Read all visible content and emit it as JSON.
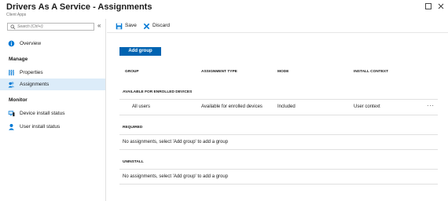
{
  "header": {
    "title": "Drivers As A Service - Assignments",
    "subtitle": "Client Apps"
  },
  "sidebar": {
    "search_placeholder": "Search (Ctrl+/)",
    "collapse_glyph": "«",
    "overview": "Overview",
    "manage_label": "Manage",
    "properties": "Properties",
    "assignments": "Assignments",
    "monitor_label": "Monitor",
    "device_install_status": "Device install status",
    "user_install_status": "User install status"
  },
  "toolbar": {
    "save_label": "Save",
    "discard_label": "Discard"
  },
  "main": {
    "add_group_label": "Add group",
    "columns": [
      "GROUP",
      "ASSIGNMENT TYPE",
      "MODE",
      "INSTALL CONTEXT"
    ],
    "sections": {
      "available": {
        "label": "AVAILABLE FOR ENROLLED DEVICES",
        "row": {
          "group": "All users",
          "assignment_type": "Available for enrolled devices",
          "mode": "Included",
          "install_context": "User context",
          "more": "···"
        }
      },
      "required": {
        "label": "REQUIRED",
        "empty": "No assignments, select 'Add group' to add a group"
      },
      "uninstall": {
        "label": "UNINSTALL",
        "empty": "No assignments, select 'Add group' to add a group"
      }
    }
  },
  "colors": {
    "accent": "#0063b1",
    "active_nav": "#dcecf9",
    "divider": "#e0e0e0"
  }
}
